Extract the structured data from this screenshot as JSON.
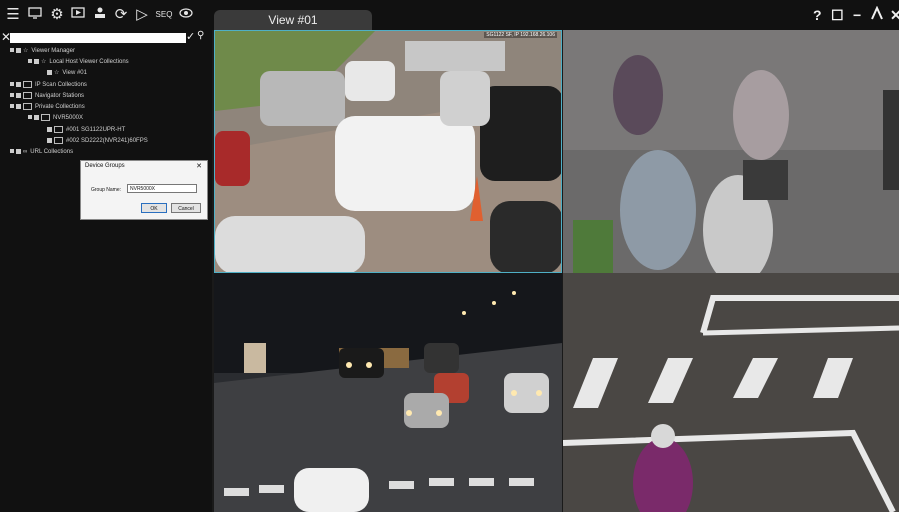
{
  "toolbar": {
    "icons": [
      "menu-icon",
      "monitor-icon",
      "settings-icon",
      "playback-icon",
      "user-upload-icon",
      "sync-icon",
      "play-icon",
      "seq-label",
      "camera-tour-icon"
    ],
    "seq_label": "SEQ"
  },
  "tabs": [
    {
      "label": "View #01"
    }
  ],
  "window_controls": {
    "help": "?",
    "maximize": "☐",
    "minimize": "−",
    "user": "ᴙ",
    "close": "✕"
  },
  "sidebar": {
    "search_placeholder": "",
    "tree": [
      {
        "label": "Viewer Manager"
      },
      {
        "label": "Local Host Viewer Collections"
      },
      {
        "label": "View #01"
      },
      {
        "label": "IP Scan Collections"
      },
      {
        "label": "Navigator Stations"
      },
      {
        "label": "Private Collections"
      },
      {
        "label": "NVR5000X"
      },
      {
        "label": "#001 SG1122UPR-HT"
      },
      {
        "label": "#002 SD2222(NVR241)60FPS"
      },
      {
        "label": "URL Collections"
      }
    ]
  },
  "dialog": {
    "title": "Device Groups",
    "group_name_label": "Group Name:",
    "group_name_value": "NVR5000X",
    "ok_label": "OK",
    "cancel_label": "Cancel"
  },
  "cameras": [
    {
      "overlay": "SG1122 SF, IP 192.168.26.106"
    },
    {
      "overlay": ""
    },
    {
      "overlay": ""
    },
    {
      "overlay": ""
    }
  ],
  "colors": {
    "accent_border": "#4fb0c6"
  }
}
